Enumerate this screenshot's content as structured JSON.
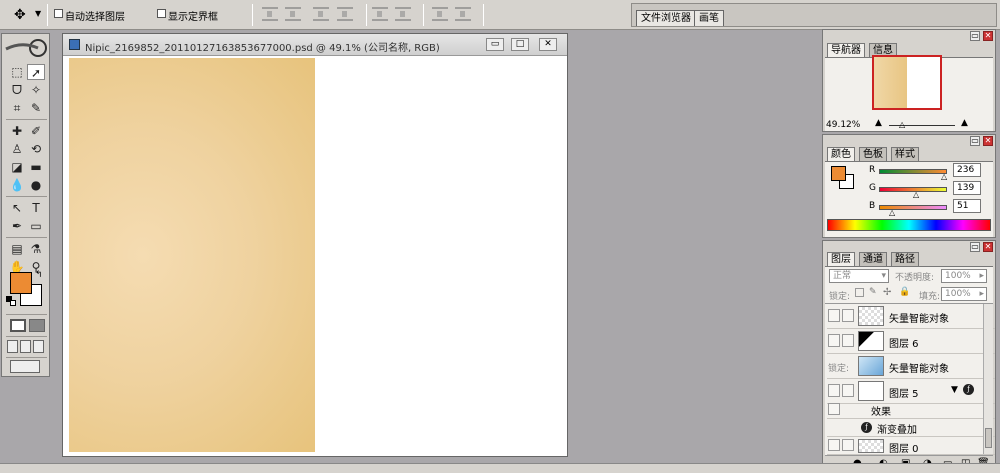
{
  "options_bar": {
    "auto_select_layer": "自动选择图层",
    "show_bounding_box": "显示定界框",
    "palette_tabs": [
      "文件浏览器",
      "画笔"
    ]
  },
  "document": {
    "title": "Nipic_2169852_20110127163853677000.psd @ 49.1% (公司名称, RGB)",
    "win_buttons": [
      "▭",
      "□",
      "✕"
    ]
  },
  "navigator": {
    "tabs": [
      "导航器",
      "信息"
    ],
    "zoom": "49.12%"
  },
  "color": {
    "tabs": [
      "颜色",
      "色板",
      "样式"
    ],
    "r_label": "R",
    "g_label": "G",
    "b_label": "B",
    "r": "236",
    "g": "139",
    "b": "51",
    "foreground": "#ec8b33"
  },
  "layers": {
    "tabs": [
      "图层",
      "通道",
      "路径"
    ],
    "blend_mode": "正常",
    "opacity_label": "不透明度:",
    "opacity": "100%",
    "lock_label": "锁定:",
    "fill_label": "填充:",
    "fill": "100%",
    "lock_label2": "锁定:",
    "items": [
      {
        "name": "矢量智能对象"
      },
      {
        "name": "图层 6"
      },
      {
        "name": "矢量智能对象"
      },
      {
        "name": "图层 5"
      },
      {
        "name": "效果"
      },
      {
        "name": "渐变叠加"
      },
      {
        "name": "图层 0"
      }
    ]
  },
  "colors": {
    "canvas_gold": "#e8c582",
    "accent_red": "#cc2222"
  }
}
